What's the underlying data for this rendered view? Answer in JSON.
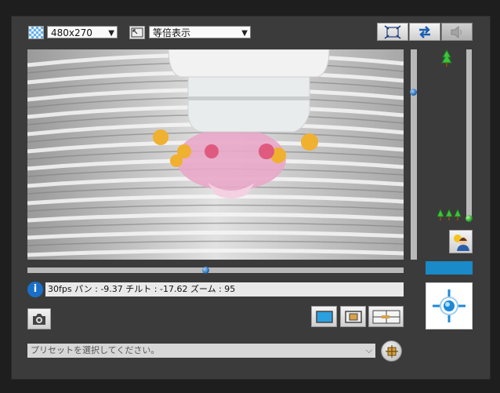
{
  "toolbar": {
    "resolution_value": "480x270",
    "display_mode_value": "等倍表示",
    "resolution_icon": "checker-grid-icon",
    "display_mode_icon": "resize-frame-icon",
    "fullscreen_icon": "fullscreen-expand-icon",
    "swap_icon": "swap-arrows-icon",
    "speaker_icon": "speaker-muted-icon"
  },
  "status": {
    "info_icon": "info-icon",
    "text": "30fps パン : -9.37 チルト : -17.62 ズーム : 95"
  },
  "bottom": {
    "snapshot_icon": "camera-icon",
    "view_single_icon": "single-view-icon",
    "view_framed_icon": "framed-view-icon",
    "view_split_icon": "split-view-icon",
    "preset_placeholder": "プリセットを選択してください。",
    "preset_go_icon": "preset-target-icon"
  },
  "right_panel": {
    "zoom_tele_icon": "single-tree-icon",
    "zoom_wide_icon": "three-trees-icon",
    "backlight_icon": "backlight-person-icon",
    "ptz_icon": "crosshair-target-icon",
    "accent_color": "#1a8ac8"
  },
  "sliders": {
    "tilt_level": 0.12,
    "pan_level": 0.5,
    "zoom_level": 1.0
  }
}
